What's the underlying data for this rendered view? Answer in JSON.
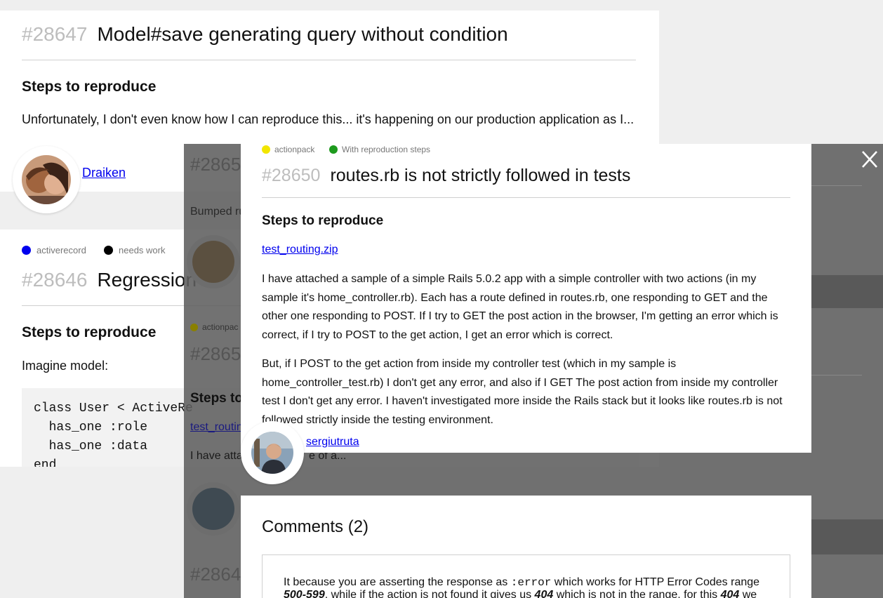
{
  "colors": {
    "actionpack": "#f2e600",
    "repro": "#1d9a1d",
    "activerecord": "#0000ee",
    "needs_work": "#000000"
  },
  "bg_issue_top": {
    "number": "#28647",
    "title": "Model#save generating query without condition",
    "steps_heading": "Steps to reproduce",
    "excerpt": "Unfortunately, I don't even know how I can reproduce this... it's happening on our production application as I...",
    "author": "Draiken"
  },
  "bg_issue_mid": {
    "tags": [
      "activerecord",
      "needs work"
    ],
    "number": "#28646",
    "title": "Regression",
    "steps_heading": "Steps to reproduce",
    "intro": "Imagine model:",
    "code_lines": [
      "class User < ActiveRe",
      "  has_one :role",
      "  has_one :data",
      "end"
    ]
  },
  "bg_list_dimmed": {
    "num_a": "#2865",
    "line_a": "Bumped ru",
    "tag_b": "actionpac",
    "num_b": "#2865",
    "steps_b": "Steps to",
    "link_b": "test_routin",
    "line_b_start": "I have attac",
    "line_b_end": "e of a...",
    "num_c": "#2864"
  },
  "modal": {
    "tags": [
      "actionpack",
      "With reproduction steps"
    ],
    "number": "#28650",
    "title": "routes.rb is not strictly followed in tests",
    "steps_heading": "Steps to reproduce",
    "attachment": "test_routing.zip",
    "paragraph1": "I have attached a sample of a simple Rails 5.0.2 app with a simple controller with two actions (in my sample it's home_controller.rb). Each has a route defined in routes.rb, one responding to GET and the other one responding to POST. If I try to GET the post action in the browser, I'm getting an error which is correct, if I try to POST to the get action, I get an error which is correct.",
    "paragraph2": "But, if I POST to the get action from inside my controller test (which in my sample is home_controller_test.rb) I don't get any error, and also if I GET The post action from inside my controller test I don't get any error. I haven't investigated more inside the Rails stack but it looks like routes.rb is not followed strictly inside the testing environment.",
    "author": "sergiutruta"
  },
  "comments": {
    "heading": "Comments (2)",
    "c1_a": "It because you are asserting the response as ",
    "c1_code": ":error",
    "c1_b": " which works for HTTP Error Codes range ",
    "c1_range": "500-599",
    "c1_c": ", while if the action is not found it gives us ",
    "c1_404a": "404",
    "c1_d": " which is not in the range, for this ",
    "c1_404b": "404",
    "c1_e": " we use"
  },
  "close_icon": "close-icon"
}
